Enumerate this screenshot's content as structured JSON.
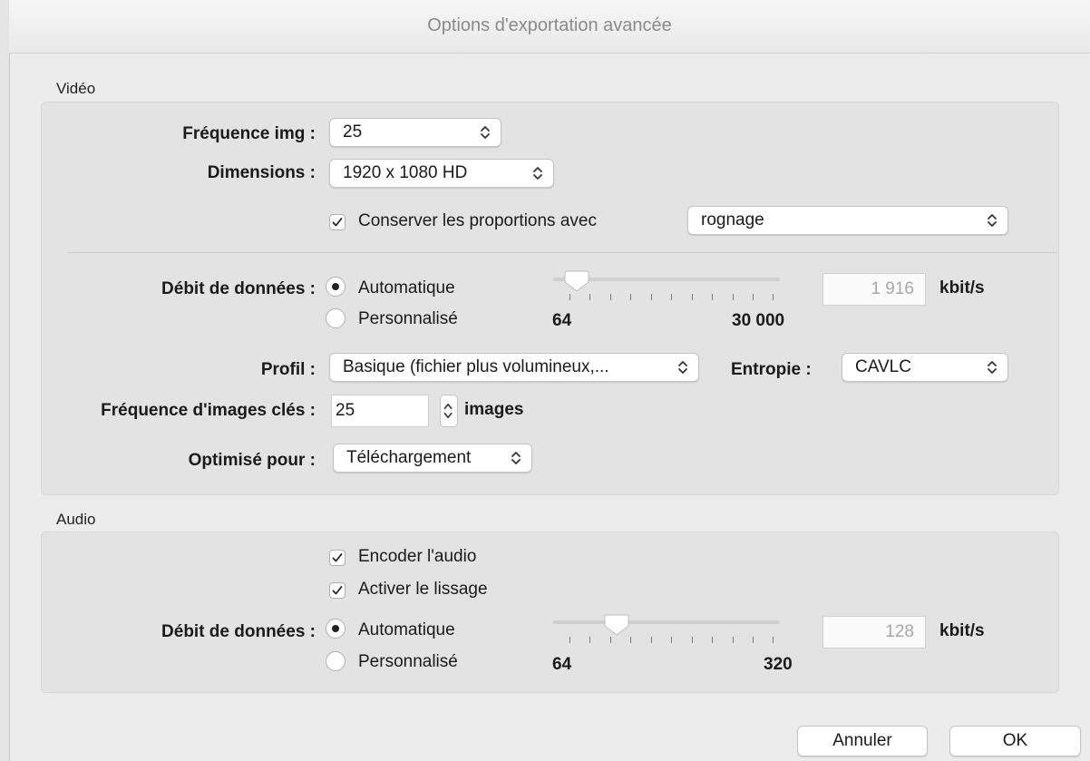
{
  "window": {
    "title": "Options d'exportation avancée"
  },
  "video": {
    "section_label": "Vidéo",
    "frame_rate": {
      "label": "Fréquence img :",
      "value": "25"
    },
    "dimensions": {
      "label": "Dimensions :",
      "value": "1920 x 1080 HD"
    },
    "keep_proportions": {
      "label": "Conserver les proportions avec",
      "checked": true,
      "mode": "rognage"
    },
    "bitrate": {
      "label": "Débit de données :",
      "auto_label": "Automatique",
      "custom_label": "Personnalisé",
      "selected": "Automatique",
      "min_label": "64",
      "max_label": "30 000",
      "value": "1 916",
      "unit": "kbit/s",
      "slider_fraction": 0.07
    },
    "profile": {
      "label": "Profil :",
      "value": "Basique (fichier plus volumineux,..."
    },
    "entropy": {
      "label": "Entropie :",
      "value": "CAVLC"
    },
    "keyframes": {
      "label": "Fréquence d'images clés :",
      "value": "25",
      "unit": "images"
    },
    "optimized": {
      "label": "Optimisé pour :",
      "value": "Téléchargement"
    }
  },
  "audio": {
    "section_label": "Audio",
    "encode": {
      "label": "Encoder l'audio",
      "checked": true
    },
    "smoothing": {
      "label": "Activer le lissage",
      "checked": true
    },
    "bitrate": {
      "label": "Débit de données :",
      "auto_label": "Automatique",
      "custom_label": "Personnalisé",
      "selected": "Automatique",
      "min_label": "64",
      "max_label": "320",
      "value": "128",
      "unit": "kbit/s",
      "slider_fraction": 0.25
    }
  },
  "buttons": {
    "cancel": "Annuler",
    "ok": "OK"
  },
  "colors": {
    "window_bg": "#ececec",
    "box_bg": "#e3e3e3",
    "field_disabled_text": "#a8a8a8"
  }
}
